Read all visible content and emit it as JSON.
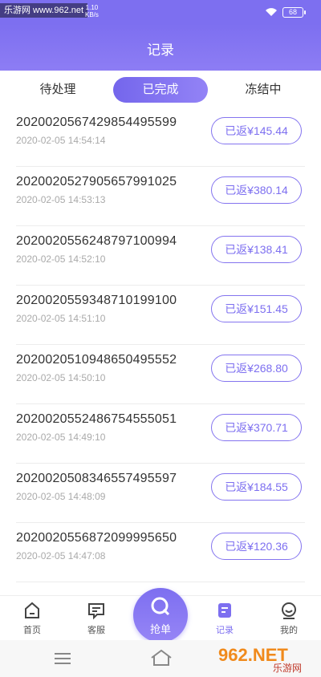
{
  "status_bar": {
    "watermark": "乐游网 www.962.net",
    "speed_value": "1.10",
    "speed_unit": "KB/s",
    "battery": "68",
    "icons": [
      "wifi-icon",
      "battery-icon"
    ]
  },
  "header": {
    "title": "记录"
  },
  "tabs": [
    {
      "label": "待处理",
      "active": false
    },
    {
      "label": "已完成",
      "active": true
    },
    {
      "label": "冻结中",
      "active": false
    }
  ],
  "records": [
    {
      "order_no": "2020020567429854495599",
      "time": "2020-02-05 14:54:14",
      "refund": "已返¥145.44"
    },
    {
      "order_no": "2020020527905657991025",
      "time": "2020-02-05 14:53:13",
      "refund": "已返¥380.14"
    },
    {
      "order_no": "2020020556248797100994",
      "time": "2020-02-05 14:52:10",
      "refund": "已返¥138.41"
    },
    {
      "order_no": "2020020559348710199100",
      "time": "2020-02-05 14:51:10",
      "refund": "已返¥151.45"
    },
    {
      "order_no": "2020020510948650495552",
      "time": "2020-02-05 14:50:10",
      "refund": "已返¥268.80"
    },
    {
      "order_no": "2020020552486754555051",
      "time": "2020-02-05 14:49:10",
      "refund": "已返¥370.71"
    },
    {
      "order_no": "2020020508346557495597",
      "time": "2020-02-05 14:48:09",
      "refund": "已返¥184.55"
    },
    {
      "order_no": "2020020556872099995650",
      "time": "2020-02-05 14:47:08",
      "refund": "已返¥120.36"
    }
  ],
  "bottom_nav": {
    "home": "首页",
    "service": "客服",
    "grab": "抢单",
    "records": "记录",
    "mine": "我的",
    "active": "records"
  },
  "colors": {
    "accent": "#7d6ff0",
    "accent_light": "#9383f6",
    "text": "#333333",
    "muted": "#aaaaaa"
  },
  "logo": {
    "text": "962.NET",
    "subtext": "乐游网"
  }
}
